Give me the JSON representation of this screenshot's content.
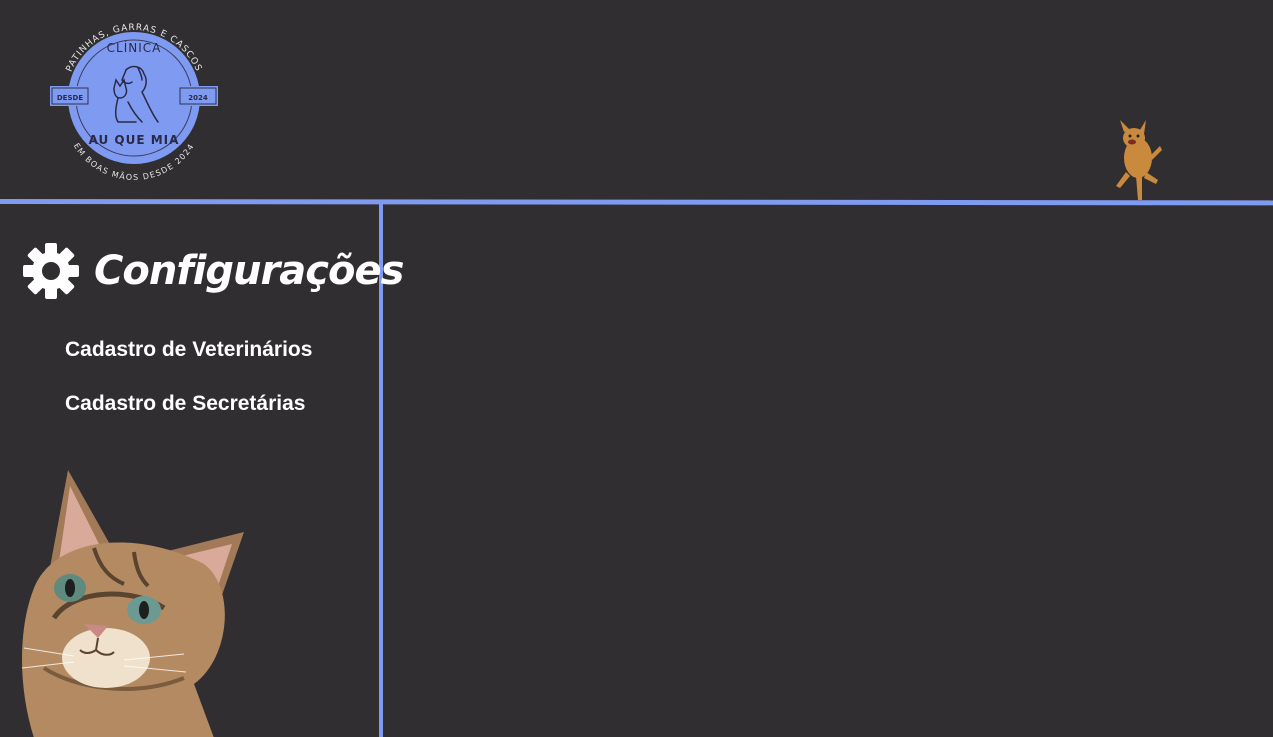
{
  "colors": {
    "background": "#302e30",
    "accent": "#7f9bf1",
    "text": "#ffffff"
  },
  "header": {
    "logo": {
      "name": "CLÍNICA",
      "brand": "AU QUE MIA",
      "top_arc": "PATINHAS, GARRAS E CASCOS",
      "bottom_arc": "EM BOAS MÃOS DESDE 2024",
      "badge_left": "DESDE",
      "badge_right": "2024"
    },
    "decoration_icon": "running-dog-icon"
  },
  "sidebar": {
    "title": "Configurações",
    "title_icon": "gear-icon",
    "items": [
      {
        "label": "Cadastro de Veterinários"
      },
      {
        "label": "Cadastro de Secretárias"
      }
    ],
    "decoration_icon": "cat-photo"
  },
  "main": {}
}
